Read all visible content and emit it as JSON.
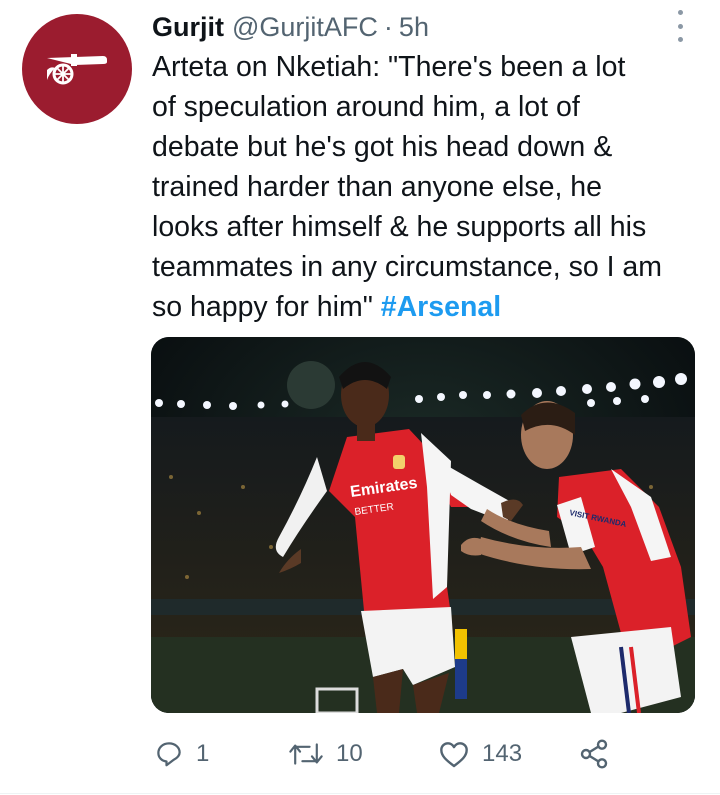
{
  "tweet": {
    "author_name": "Gurjit",
    "handle": "@GurjitAFC",
    "separator": "·",
    "time": "5h",
    "text_lines": [
      "Arteta on Nketiah: \"There's been a lot",
      "of speculation around him, a lot of",
      "debate but he's got his head down &",
      "trained harder than anyone else, he",
      "looks after himself & he supports all his",
      "teammates in any circumstance, so I am",
      "so happy for him\" "
    ],
    "hashtag": "#Arsenal",
    "media": {
      "shirt_sponsor": "Emirates",
      "shirt_sponsor_line2": "BETTER",
      "sleeve_text": "VISIT RWANDA"
    },
    "actions": {
      "replies": "1",
      "retweets": "10",
      "likes": "143"
    },
    "colors": {
      "avatar_bg": "#9b1c2f",
      "hashtag": "#1d9bf0",
      "muted": "#536471",
      "kit_red": "#db2129"
    },
    "icons": [
      "arsenal-cannon-icon",
      "more-options-icon",
      "reply-icon",
      "retweet-icon",
      "like-icon",
      "share-icon"
    ]
  }
}
